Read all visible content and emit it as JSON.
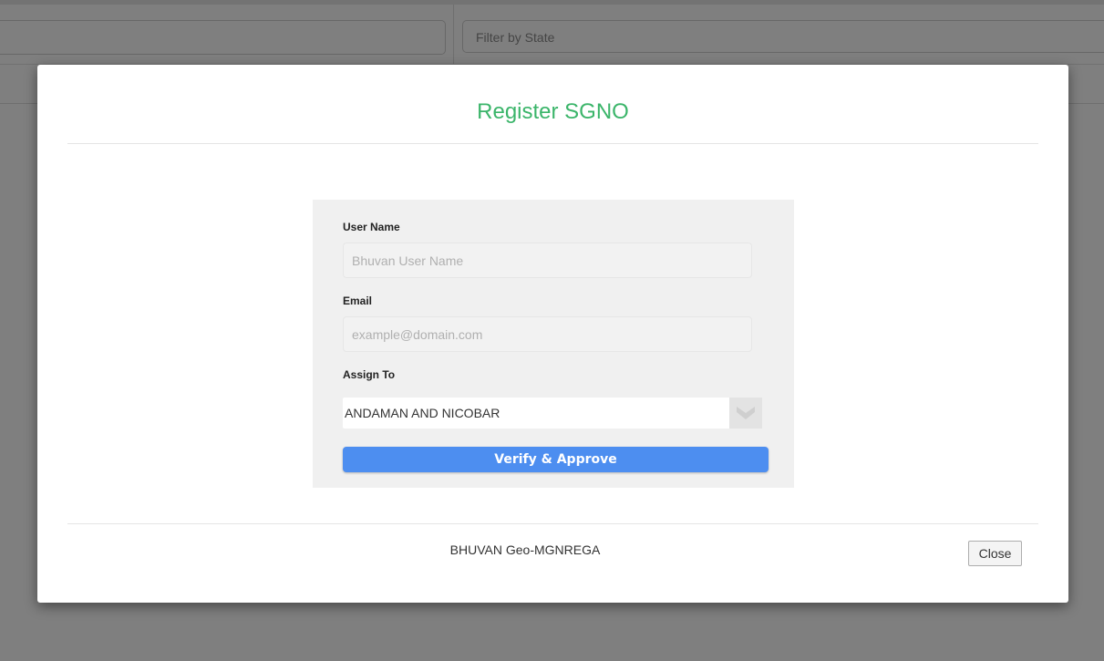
{
  "background": {
    "filter_state_placeholder": "Filter by State"
  },
  "modal": {
    "title": "Register SGNO",
    "form": {
      "username_label": "User Name",
      "username_placeholder": "Bhuvan User Name",
      "email_label": "Email",
      "email_placeholder": "example@domain.com",
      "assign_label": "Assign To",
      "assign_selected": "ANDAMAN AND NICOBAR",
      "submit_label": "Verify  &  Approve"
    },
    "footer": {
      "text": "BHUVAN Geo-MGNREGA",
      "close_label": "Close"
    }
  },
  "colors": {
    "title": "#3bb56a",
    "submit_button": "#4d8ef0",
    "overlay": "#808080"
  },
  "icons": {
    "select_arrow": "chevron-down-icon"
  }
}
